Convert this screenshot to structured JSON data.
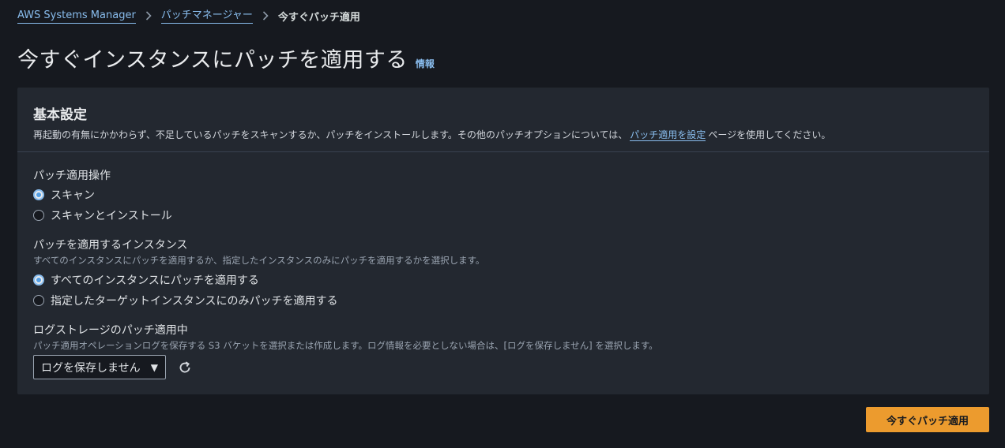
{
  "breadcrumb": {
    "items": [
      "AWS Systems Manager",
      "パッチマネージャー"
    ],
    "current": "今すぐパッチ適用"
  },
  "page": {
    "title": "今すぐインスタンスにパッチを適用する",
    "info": "情報"
  },
  "settings": {
    "title": "基本設定",
    "desc_before": "再起動の有無にかかわらず、不足しているパッチをスキャンするか、パッチをインストールします。その他のパッチオプションについては、",
    "desc_link": "パッチ適用を設定",
    "desc_after": "ページを使用してください。"
  },
  "operation": {
    "label": "パッチ適用操作",
    "options": [
      "スキャン",
      "スキャンとインストール"
    ],
    "selected": 0
  },
  "instances": {
    "label": "パッチを適用するインスタンス",
    "desc": "すべてのインスタンスにパッチを適用するか、指定したインスタンスのみにパッチを適用するかを選択します。",
    "options": [
      "すべてのインスタンスにパッチを適用する",
      "指定したターゲットインスタンスにのみパッチを適用する"
    ],
    "selected": 0
  },
  "logs": {
    "label": "ログストレージのパッチ適用中",
    "desc": "パッチ適用オペレーションログを保存する S3 バケットを選択または作成します。ログ情報を必要としない場合は、[ログを保存しません] を選択します。",
    "select_value": "ログを保存しません"
  },
  "actions": {
    "apply_label": "今すぐパッチ適用"
  },
  "colors": {
    "accent": "#89bdee",
    "primary_button": "#ec9b2e",
    "background": "#16191f",
    "panel": "#232830"
  }
}
